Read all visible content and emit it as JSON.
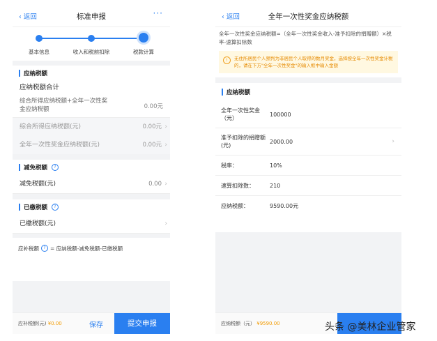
{
  "left": {
    "back": "返回",
    "title": "标准申报",
    "more": "···",
    "steps": [
      "基本信息",
      "收入和税前扣除",
      "税款计算"
    ],
    "sec1_title": "应纳税额",
    "total_label": "应纳税额合计",
    "formula_row": {
      "label": "综合所得应纳税额+全年一次性奖金应纳税额",
      "value": "0.00元"
    },
    "item_rows": [
      {
        "label": "综合所得应纳税额(元)",
        "value": "0.00元"
      },
      {
        "label": "全年一次性奖金应纳税额(元)",
        "value": "0.00元"
      }
    ],
    "sec2_title": "减免税额",
    "reduce_row": {
      "label": "减免税额(元)",
      "value": "0.00"
    },
    "sec3_title": "已缴税额",
    "paid_row": {
      "label": "已缴税额(元)"
    },
    "bottom_formula": {
      "label": "应补税额",
      "text": "= 应纳税额-减免税额-已缴税额"
    },
    "footer": {
      "label": "应补税额(元)",
      "amount": "¥0.00",
      "save": "保存",
      "submit": "提交申报"
    }
  },
  "right": {
    "back": "返回",
    "title": "全年一次性奖金应纳税额",
    "desc": "全年一次性奖金应纳税额=（全年一次性奖金收入-准予扣除的捐赠额）×税率-速算扣除数",
    "tip": "无住所居民个人预判为非居民个人取得的数月奖金，选择按全年一次性奖金计税的，请在下方\"全年一次性奖金\"的输入框中输入金额",
    "section_title": "应纳税额",
    "rows": [
      {
        "label": "全年一次性奖金（元）",
        "value": "100000"
      },
      {
        "label": "准予扣除的捐赠额(元)",
        "value": "2000.00"
      },
      {
        "label": "税率：",
        "value": "10%"
      },
      {
        "label": "速算扣除数：",
        "value": "210"
      },
      {
        "label": "应纳税额：",
        "value": "9590.00元"
      }
    ],
    "footer": {
      "label": "应纳税额（元）",
      "amount": "¥9590.00"
    }
  },
  "watermark": "头条 @美林企业管家",
  "colors": {
    "accent": "#2a7ff0",
    "warning": "#f29b00",
    "tip_bg": "#fff8e1"
  }
}
